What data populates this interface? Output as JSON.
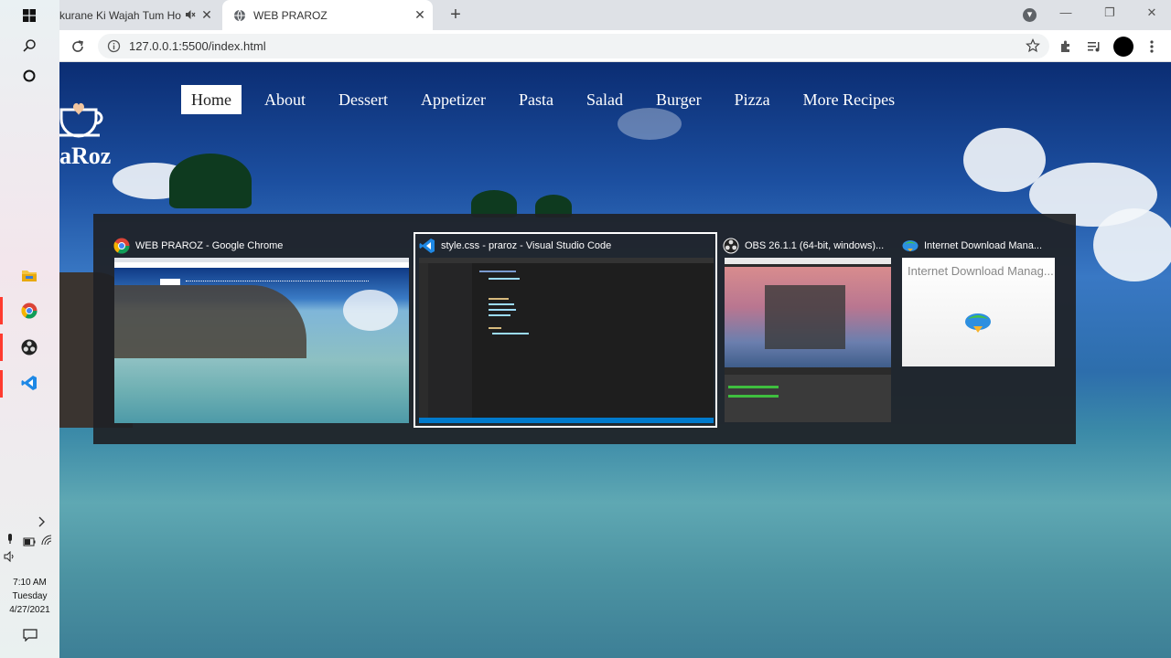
{
  "taskbar": {
    "clock": {
      "time": "7:10 AM",
      "day": "Tuesday",
      "date": "4/27/2021"
    }
  },
  "browser": {
    "tabs": [
      {
        "label": "kurane Ki Wajah Tum Ho"
      },
      {
        "label": "WEB PRAROZ"
      }
    ],
    "url": "127.0.0.1:5500/index.html"
  },
  "site": {
    "logo_text": "aRoz",
    "nav": [
      "Home",
      "About",
      "Dessert",
      "Appetizer",
      "Pasta",
      "Salad",
      "Burger",
      "Pizza",
      "More Recipes"
    ]
  },
  "switcher": {
    "windows": [
      {
        "title": "WEB PRAROZ - Google Chrome",
        "icon": "chrome-icon"
      },
      {
        "title": "style.css - praroz - Visual Studio Code",
        "icon": "vscode-icon",
        "selected": true
      },
      {
        "title": "OBS 26.1.1 (64-bit, windows)...",
        "icon": "obs-icon"
      },
      {
        "title": "Internet Download Mana...",
        "icon": "idm-icon"
      }
    ],
    "idm_thumb_title": "Internet Download Manag..."
  },
  "colors": {
    "accent_red": "#ff3b2f",
    "vscode_blue": "#007acc",
    "switcher_bg": "#1f2126"
  }
}
